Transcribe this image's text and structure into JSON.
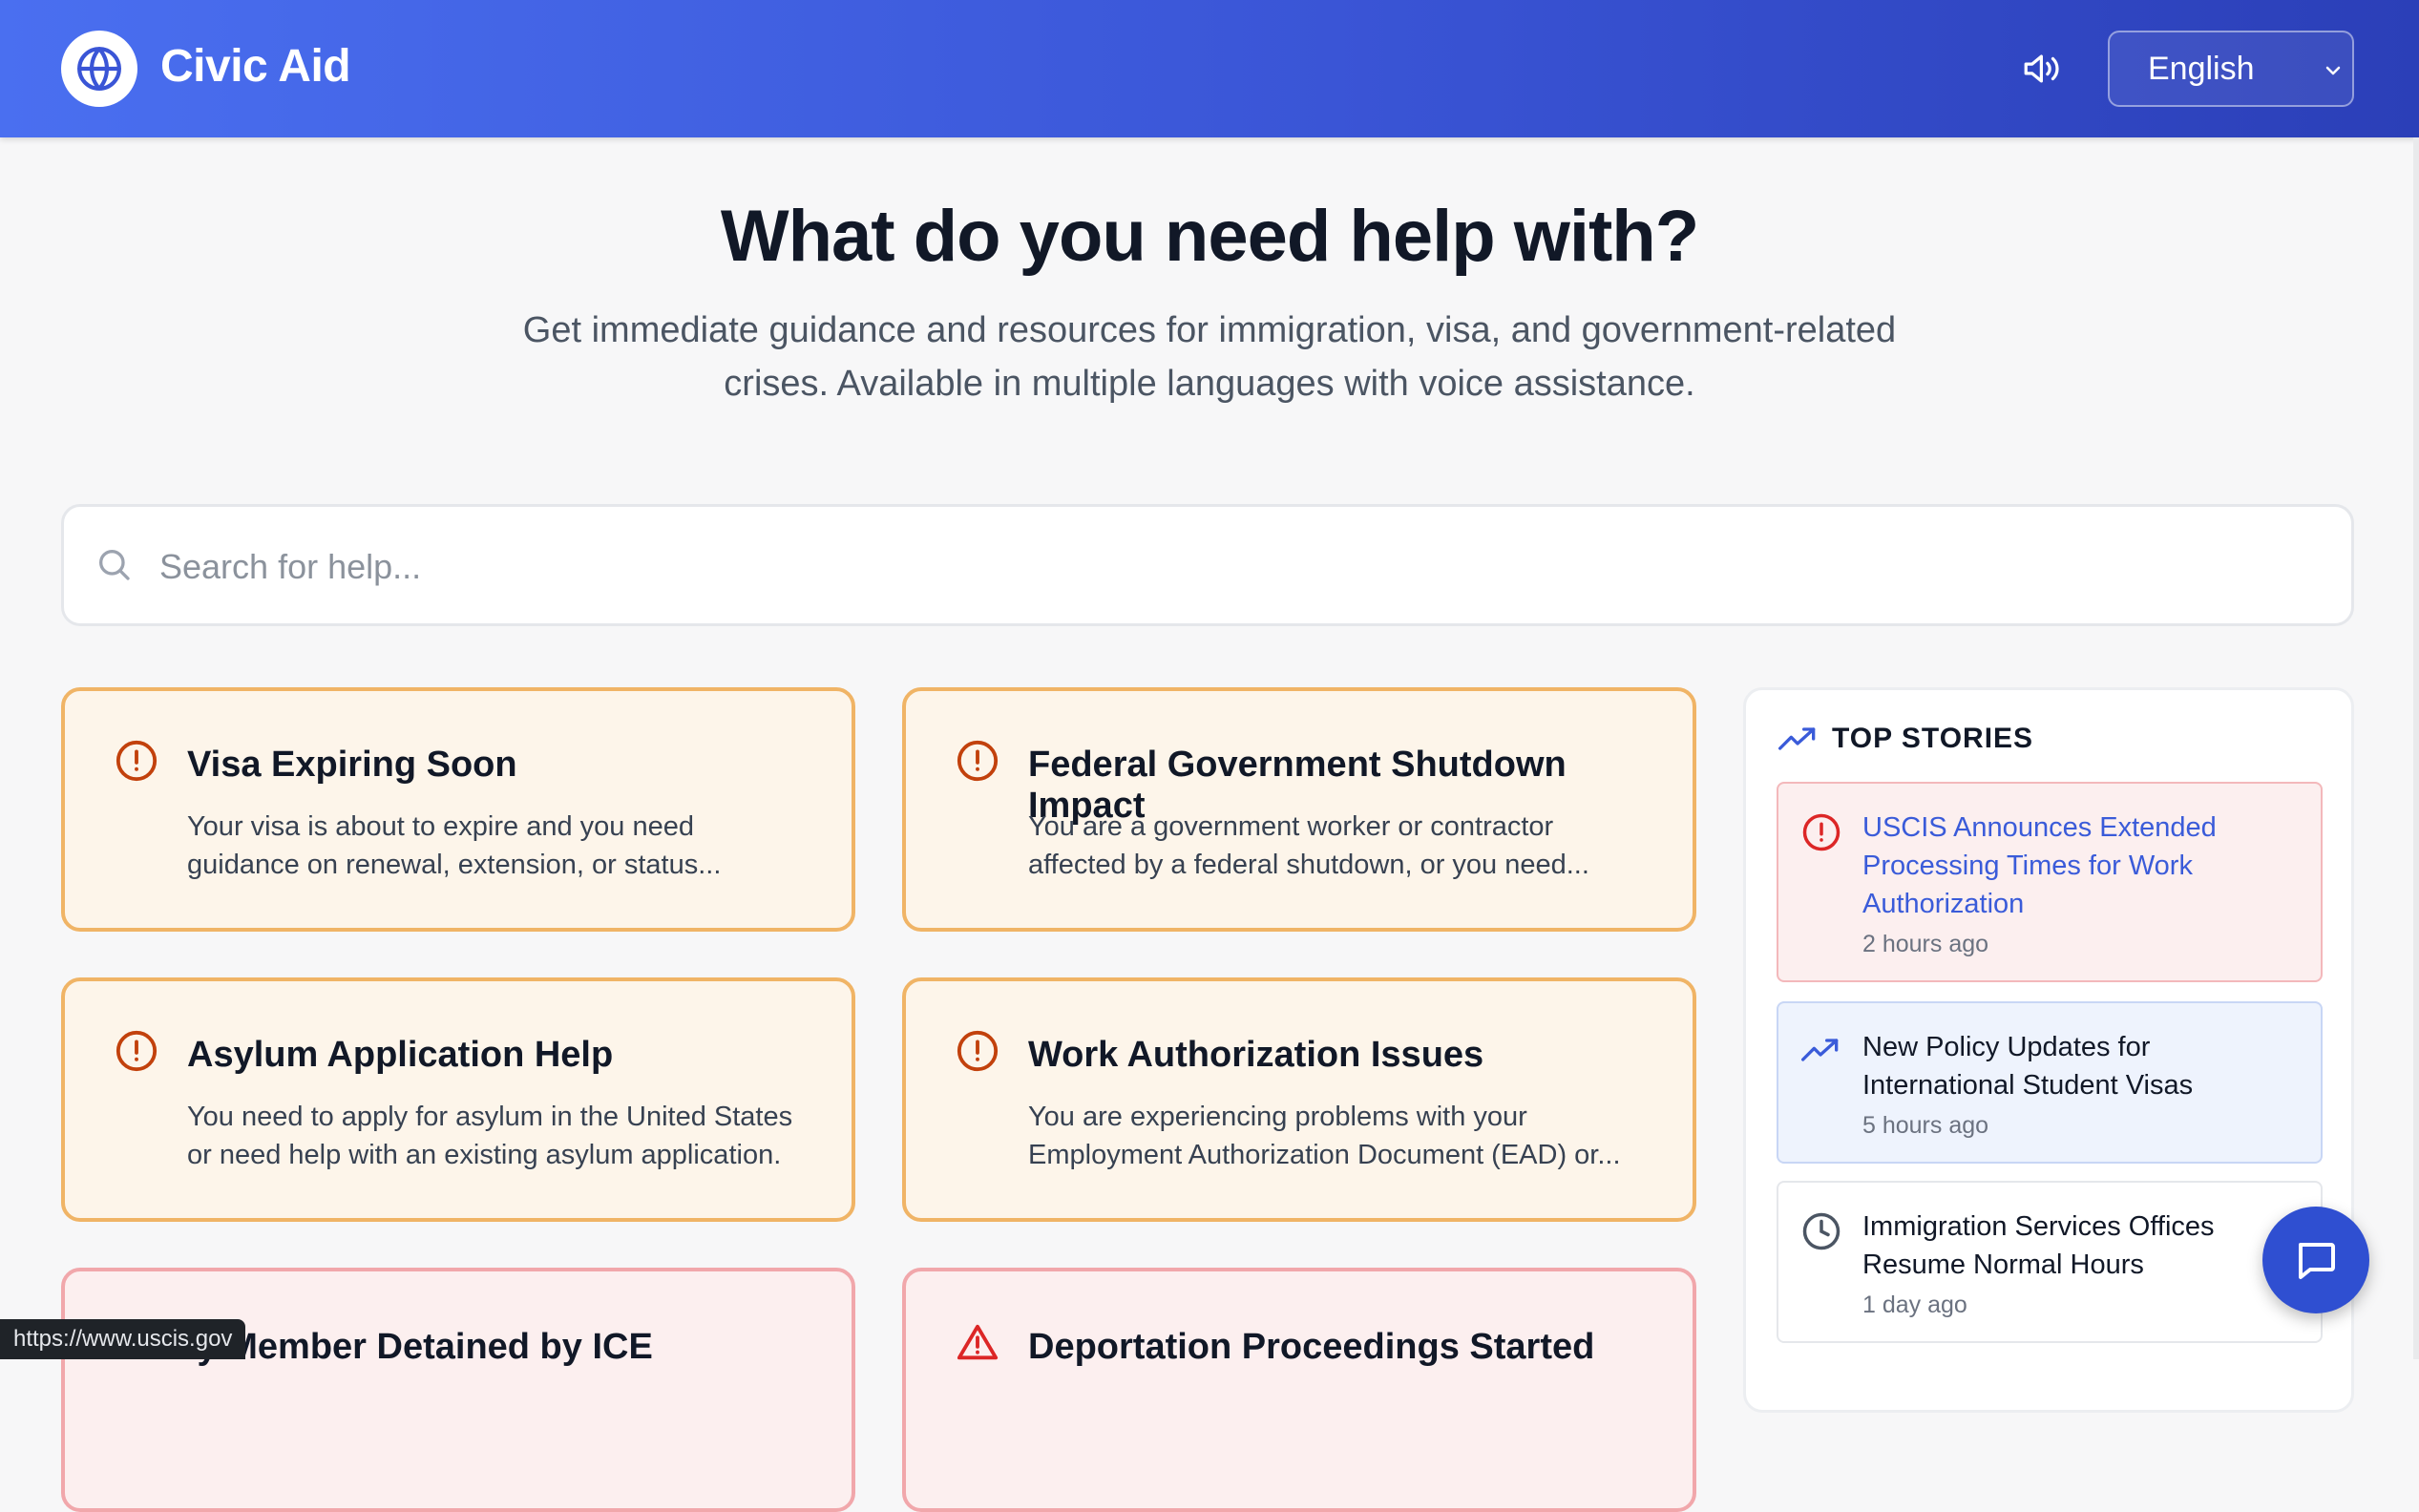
{
  "header": {
    "brand": "Civic Aid",
    "logo_icon": "globe-icon",
    "voice_icon": "speaker-icon",
    "language": "English"
  },
  "hero": {
    "title": "What do you need help with?",
    "subtitle_line1": "Get immediate guidance and resources for immigration, visa, and government-related",
    "subtitle_line2": "crises. Available in multiple languages with voice assistance."
  },
  "search": {
    "placeholder": "Search for help..."
  },
  "cards": [
    {
      "title": "Visa Expiring Soon",
      "desc1": "Your visa is about to expire and you need",
      "desc2": "guidance on renewal, extension, or status...",
      "icon": "alert-circle-icon"
    },
    {
      "title": "Federal Government Shutdown Impact",
      "desc1": "You are a government worker or contractor",
      "desc2": "affected by a federal shutdown, or you need...",
      "icon": "alert-circle-icon"
    },
    {
      "title": "Asylum Application Help",
      "desc1": "You need to apply for asylum in the United States",
      "desc2": "or need help with an existing asylum application.",
      "icon": "alert-circle-icon"
    },
    {
      "title": "Work Authorization Issues",
      "desc1": "You are experiencing problems with your",
      "desc2": "Employment Authorization Document (EAD) or...",
      "icon": "alert-circle-icon"
    },
    {
      "title": "ly Member Detained by ICE",
      "icon": "alert-triangle-icon"
    },
    {
      "title": "Deportation Proceedings Started",
      "icon": "alert-triangle-icon"
    }
  ],
  "top_stories": {
    "heading": "TOP STORIES",
    "icon": "trending-up-icon",
    "items": [
      {
        "title1": "USCIS Announces Extended",
        "title2": "Processing Times for Work",
        "title3": "Authorization",
        "time": "2 hours ago",
        "icon": "alert-circle-icon"
      },
      {
        "title1": "New Policy Updates for",
        "title2": "International Student Visas",
        "time": "5 hours ago",
        "icon": "trending-up-icon"
      },
      {
        "title1": "Immigration Services Offices",
        "title2": "Resume Normal Hours",
        "time": "1 day ago",
        "icon": "clock-icon"
      }
    ]
  },
  "chat": {
    "icon": "chat-icon"
  },
  "status_bar": {
    "url": "https://www.uscis.gov"
  },
  "colors": {
    "header_start": "#4a6ff0",
    "header_end": "#2b3fb8",
    "warning_border": "#f0b466",
    "warning_bg": "#fdf5ea",
    "danger_border": "#f1a7ab",
    "danger_bg": "#fcefef",
    "accent": "#2f4fd1"
  }
}
